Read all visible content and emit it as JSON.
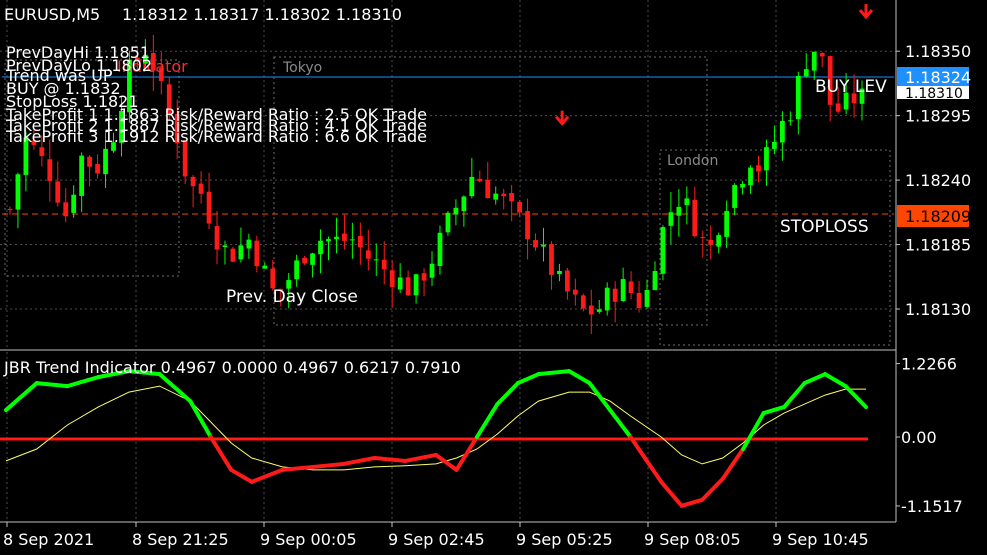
{
  "colors": {
    "background": "#000000",
    "grid": "#4d4d4d",
    "frame": "#c0c0c0",
    "bull": "#00ff00",
    "bear": "#ff1a1a",
    "text": "#ffffff",
    "buy_badge": "#1e90ff",
    "stop_badge": "#ff4500",
    "signal_line": "#ffff66",
    "session_box": "#6e6e6e"
  },
  "header": {
    "symbol_timeframe": "EURUSD,M5",
    "ohlc": "1.18312 1.18317 1.18302 1.18310"
  },
  "trade_info": [
    "PrevDayHi 1.1851",
    "PrevDayLo 1.1802",
    "Trend was UP",
    "BUY @ 1.1832",
    "StopLoss 1.1821",
    "TakeProfit 1 1.1863 Risk/Reward Ratio : 2.5 OK Trade",
    "TakeProfit 2 1.1887 Risk/Reward Ratio : 4.1 OK Trade",
    "TakeProfit 3 1.1912 Risk/Reward Ratio : 6.6 OK Trade"
  ],
  "indicator_ghost_label": "Indicator",
  "session_labels": {
    "tokyo": "Tokyo",
    "london": "London"
  },
  "chart_annotations": {
    "prev_day_close": "Prev. Day Close",
    "buy_level": "BUY LEV",
    "stoploss": "STOPLOSS"
  },
  "levels": {
    "buy": 1.18324,
    "stoploss": 1.18209
  },
  "badges": {
    "buy": "1.18324",
    "current": "1.18310",
    "stoploss": "1.18209"
  },
  "x_axis_labels": [
    "8 Sep 2021",
    "8 Sep 21:25",
    "9 Sep 00:05",
    "9 Sep 02:45",
    "9 Sep 05:25",
    "9 Sep 08:05",
    "9 Sep 10:45"
  ],
  "chart_data": [
    {
      "type": "candlestick",
      "title": "EURUSD,M5",
      "y_ticks": [
        1.1835,
        1.18295,
        1.1824,
        1.18185,
        1.1813
      ],
      "y_tick_labels": [
        "1.18350",
        "1.18295",
        "1.18240",
        "1.18185",
        "1.18130"
      ],
      "ylim": [
        1.18095,
        1.18392
      ],
      "grid": true,
      "candle_count": 108,
      "close_path": [
        [
          0,
          1.18215
        ],
        [
          3,
          1.18275
        ],
        [
          5,
          1.18265
        ],
        [
          8,
          1.18245
        ],
        [
          11,
          1.1821
        ],
        [
          14,
          1.1826
        ],
        [
          17,
          1.1825
        ],
        [
          20,
          1.18275
        ],
        [
          23,
          1.1833
        ],
        [
          27,
          1.18355
        ],
        [
          30,
          1.1831
        ],
        [
          33,
          1.18275
        ],
        [
          35,
          1.18235
        ],
        [
          38,
          1.18228
        ],
        [
          40,
          1.18195
        ],
        [
          43,
          1.18175
        ],
        [
          47,
          1.1819
        ],
        [
          50,
          1.1816
        ],
        [
          52,
          1.1814
        ],
        [
          55,
          1.18158
        ],
        [
          58,
          1.1818
        ],
        [
          61,
          1.1819
        ],
        [
          64,
          1.18188
        ],
        [
          67,
          1.1819
        ],
        [
          70,
          1.18175
        ],
        [
          73,
          1.18165
        ],
        [
          76,
          1.18155
        ],
        [
          79,
          1.18145
        ],
        [
          83,
          1.18175
        ],
        [
          86,
          1.18205
        ],
        [
          89,
          1.1823
        ],
        [
          91,
          1.18248
        ],
        [
          93,
          1.18235
        ],
        [
          96,
          1.18225
        ],
        [
          99,
          1.1821
        ],
        [
          102,
          1.18195
        ],
        [
          104,
          1.1818
        ],
        [
          106,
          1.18165
        ],
        [
          108,
          1.1815
        ],
        [
          110,
          1.1814
        ],
        [
          112,
          1.18128
        ],
        [
          115,
          1.18128
        ],
        [
          118,
          1.18145
        ],
        [
          121,
          1.1815
        ],
        [
          123,
          1.18135
        ],
        [
          125,
          1.18145
        ],
        [
          127,
          1.18185
        ],
        [
          129,
          1.1821
        ],
        [
          131,
          1.18225
        ],
        [
          133,
          1.18215
        ],
        [
          135,
          1.18195
        ],
        [
          137,
          1.18178
        ],
        [
          139,
          1.18205
        ],
        [
          141,
          1.1823
        ],
        [
          143,
          1.1824
        ],
        [
          145,
          1.1826
        ],
        [
          147,
          1.1825
        ],
        [
          149,
          1.18265
        ],
        [
          151,
          1.18285
        ],
        [
          153,
          1.183
        ],
        [
          155,
          1.1833
        ],
        [
          157,
          1.18355
        ],
        [
          159,
          1.18345
        ],
        [
          161,
          1.183
        ],
        [
          163,
          1.183
        ],
        [
          165,
          1.1831
        ],
        [
          167,
          1.1831
        ]
      ],
      "sell_arrows": [
        {
          "index": 108,
          "price": 1.18289
        },
        {
          "index": 167,
          "price": 1.1838
        }
      ],
      "prev_day_close": 1.1814,
      "buy_level": 1.18324,
      "stoploss_level": 1.18209,
      "current_price": 1.1831
    },
    {
      "type": "line",
      "title": "JBR Trend Indicator 0.4967 0.0000 0.4967 0.6217 0.7910",
      "y_ticks": [
        1.2266,
        0.0,
        -1.1517
      ],
      "y_tick_labels": [
        "1.2266",
        "0.00",
        "-1.1517"
      ],
      "ylim": [
        -1.42,
        1.42
      ],
      "x": [
        0,
        6,
        12,
        18,
        24,
        30,
        36,
        40,
        44,
        48,
        54,
        60,
        66,
        72,
        78,
        84,
        88,
        92,
        96,
        100,
        104,
        110,
        114,
        118,
        122,
        128,
        132,
        136,
        140,
        144,
        148,
        152,
        156,
        160,
        164,
        168
      ],
      "series": [
        {
          "values": [
            0.45,
            0.9,
            0.85,
            1.0,
            1.1,
            1.05,
            0.6,
            0.0,
            -0.55,
            -0.75,
            -0.55,
            -0.5,
            -0.45,
            -0.35,
            -0.4,
            -0.3,
            -0.55,
            0.0,
            0.55,
            0.9,
            1.05,
            1.1,
            0.9,
            0.45,
            0.0,
            -0.75,
            -1.15,
            -1.05,
            -0.7,
            -0.2,
            0.4,
            0.5,
            0.9,
            1.05,
            0.85,
            0.5
          ]
        },
        {
          "values": [
            -0.4,
            -0.2,
            0.2,
            0.5,
            0.75,
            0.85,
            0.6,
            0.25,
            -0.1,
            -0.35,
            -0.5,
            -0.55,
            -0.55,
            -0.5,
            -0.48,
            -0.45,
            -0.35,
            -0.2,
            0.05,
            0.35,
            0.6,
            0.75,
            0.75,
            0.6,
            0.35,
            0.0,
            -0.3,
            -0.45,
            -0.35,
            -0.1,
            0.2,
            0.4,
            0.55,
            0.7,
            0.8,
            0.8
          ]
        }
      ],
      "zero_line": 0.0
    }
  ]
}
